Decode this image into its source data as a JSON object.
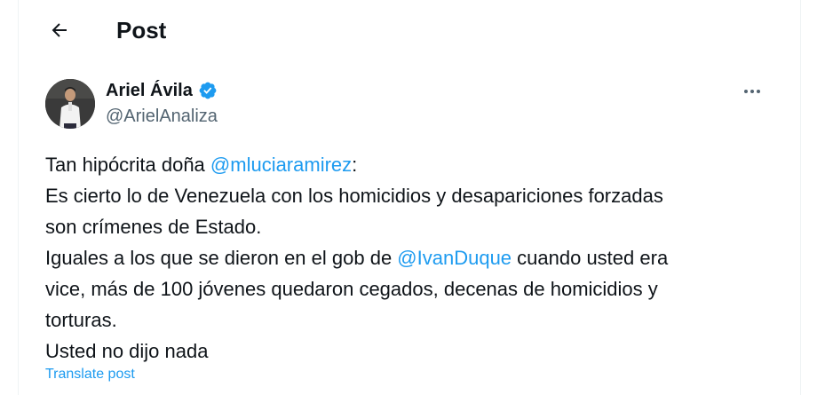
{
  "header": {
    "title": "Post",
    "back_icon": "arrow-left-icon"
  },
  "author": {
    "name": "Ariel Ávila",
    "handle": "@ArielAnaliza",
    "verified_icon": "verified-badge-icon",
    "verified_color": "#1d9bf0"
  },
  "more_icon": "more-horizontal-icon",
  "tweet": {
    "line1_text": "Tan hipócrita doña ",
    "line1_mention": "@mluciaramirez",
    "line1_end": ":",
    "line2": "Es cierto lo de Venezuela con los homicidios y desapariciones forzadas",
    "line3": "son crímenes de Estado.",
    "line4_text": "Iguales a los que se dieron en el gob de ",
    "line4_mention": "@IvanDuque",
    "line4_end": " cuando usted era",
    "line5": "vice, más de 100 jóvenes quedaron cegados, decenas de homicidios y",
    "line6": "torturas.",
    "line7": "Usted no dijo nada"
  },
  "translate_label": "Translate post",
  "colors": {
    "text": "#0f1419",
    "secondary": "#536471",
    "link": "#1d9bf0",
    "border": "#eff3f4"
  }
}
